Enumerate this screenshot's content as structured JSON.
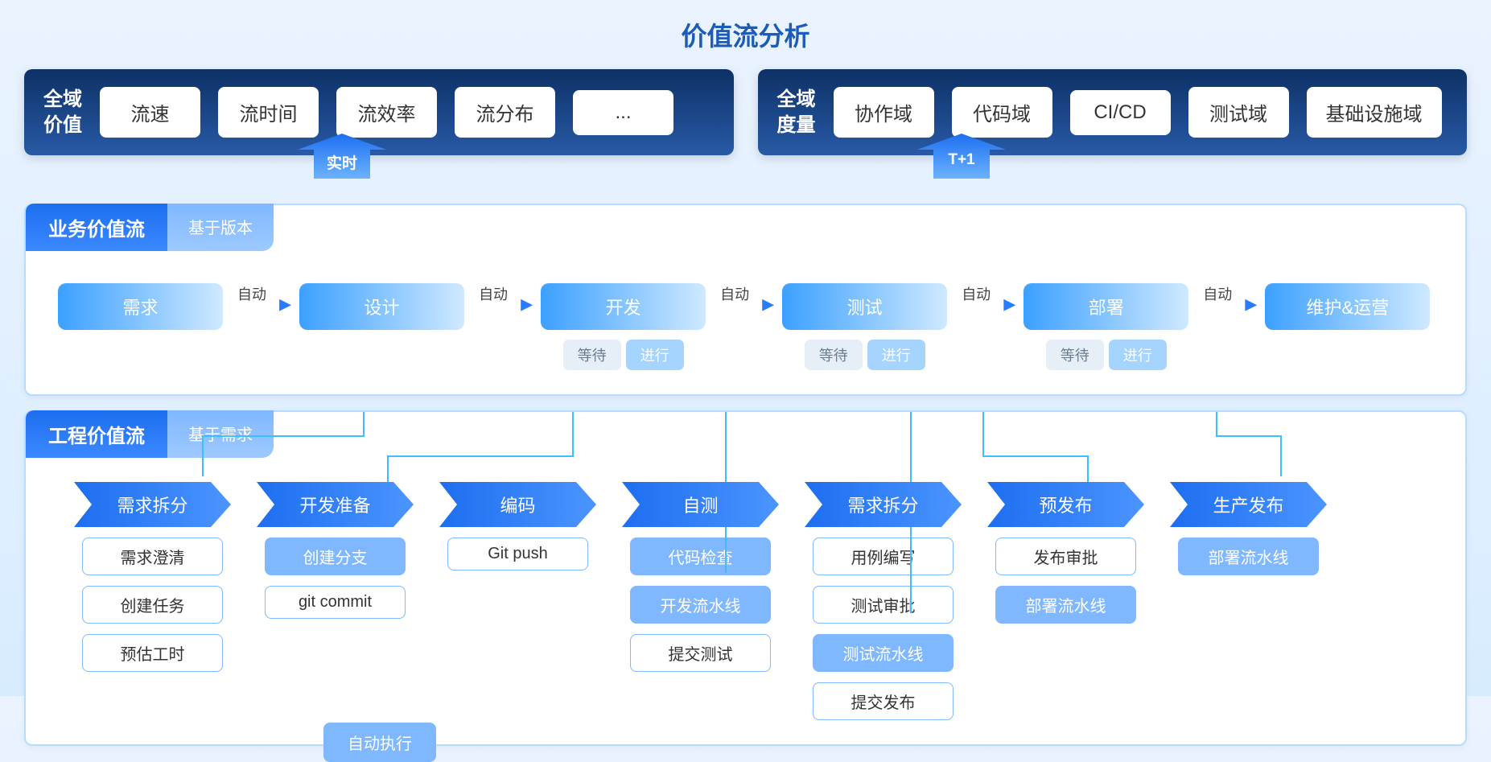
{
  "title": "价值流分析",
  "top_left": {
    "label": "全域\n价值",
    "chips": [
      "流速",
      "流时间",
      "流效率",
      "流分布",
      "..."
    ]
  },
  "top_right": {
    "label": "全域\n度量",
    "chips": [
      "协作域",
      "代码域",
      "CI/CD",
      "测试域",
      "基础设施域"
    ]
  },
  "arrows": {
    "realtime": "实时",
    "t1": "T+1"
  },
  "biz": {
    "title": "业务价值流",
    "sub": "基于版本",
    "auto": "自动",
    "wait": "等待",
    "going": "进行",
    "stages": [
      {
        "name": "需求",
        "sub": false
      },
      {
        "name": "设计",
        "sub": false
      },
      {
        "name": "开发",
        "sub": true
      },
      {
        "name": "测试",
        "sub": true
      },
      {
        "name": "部署",
        "sub": true
      },
      {
        "name": "维护&运营",
        "sub": false
      }
    ]
  },
  "eng": {
    "title": "工程价值流",
    "sub": "基于需求",
    "legend": "自动执行",
    "cols": [
      {
        "head": "需求拆分",
        "tasks": [
          {
            "t": "需求澄清",
            "b": false
          },
          {
            "t": "创建任务",
            "b": false
          },
          {
            "t": "预估工时",
            "b": false
          }
        ]
      },
      {
        "head": "开发准备",
        "tasks": [
          {
            "t": "创建分支",
            "b": true
          },
          {
            "t": "git commit",
            "b": false
          }
        ]
      },
      {
        "head": "编码",
        "tasks": [
          {
            "t": "Git push",
            "b": false
          }
        ]
      },
      {
        "head": "自测",
        "tasks": [
          {
            "t": "代码检查",
            "b": true
          },
          {
            "t": "开发流水线",
            "b": true
          },
          {
            "t": "提交测试",
            "b": false
          }
        ]
      },
      {
        "head": "需求拆分",
        "tasks": [
          {
            "t": "用例编写",
            "b": false
          },
          {
            "t": "测试审批",
            "b": false
          },
          {
            "t": "测试流水线",
            "b": true
          },
          {
            "t": "提交发布",
            "b": false
          }
        ]
      },
      {
        "head": "预发布",
        "tasks": [
          {
            "t": "发布审批",
            "b": false
          },
          {
            "t": "部署流水线",
            "b": true
          }
        ]
      },
      {
        "head": "生产发布",
        "tasks": [
          {
            "t": "部署流水线",
            "b": true
          }
        ]
      }
    ]
  }
}
